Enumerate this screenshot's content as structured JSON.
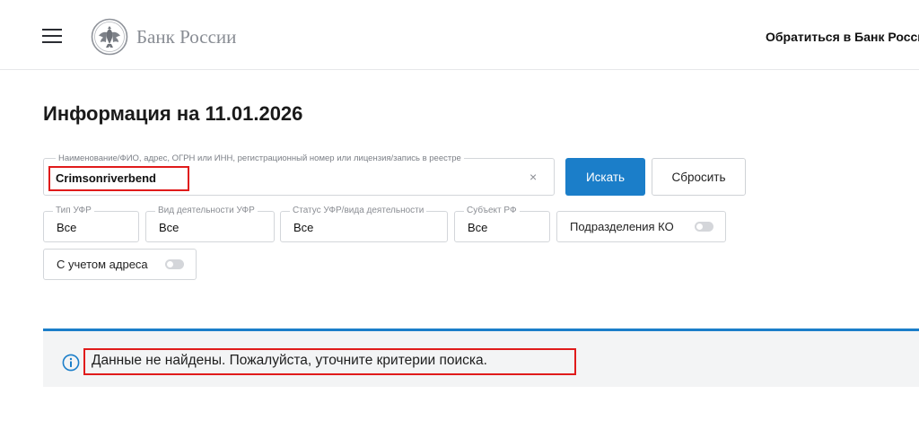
{
  "header": {
    "logo_text": "Банк России",
    "contact_link": "Обратиться в Банк Росси"
  },
  "page": {
    "title": "Информация на 11.01.2026"
  },
  "search": {
    "label": "Наименование/ФИО, адрес, ОГРН или ИНН, регистрационный номер или лицензия/запись в реестре",
    "value": "Crimsonriverbend",
    "clear": "×",
    "search_button": "Искать",
    "reset_button": "Сбросить"
  },
  "filters": [
    {
      "label": "Тип УФР",
      "value": "Все"
    },
    {
      "label": "Вид деятельности УФР",
      "value": "Все"
    },
    {
      "label": "Статус УФР/вида деятельности",
      "value": "Все"
    },
    {
      "label": "Субъект РФ",
      "value": "Все"
    }
  ],
  "toggles": {
    "branches": {
      "label": "Подразделения КО",
      "on": false
    },
    "address": {
      "label": "С учетом адреса",
      "on": false
    }
  },
  "notice": {
    "text": "Данные не найдены. Пожалуйста, уточните критерии поиска."
  },
  "colors": {
    "accent": "#1b7ec9",
    "highlight": "#e01b1b",
    "notice_bg": "#f3f4f5"
  },
  "icons": [
    "hamburger-menu-icon",
    "bank-of-russia-eagle-logo",
    "clear-icon",
    "info-icon"
  ]
}
